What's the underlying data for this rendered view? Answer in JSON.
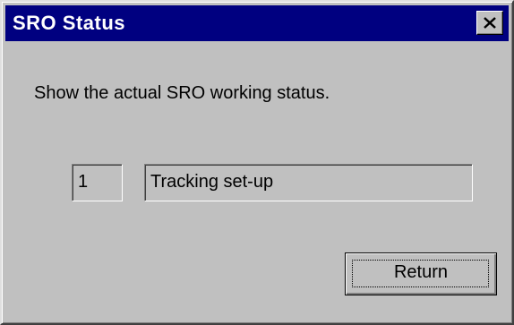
{
  "window": {
    "title": "SRO Status",
    "close_icon": "close-x-icon"
  },
  "body": {
    "description": "Show the actual SRO working status.",
    "status_number": "1",
    "status_text": "Tracking set-up"
  },
  "buttons": {
    "return_label": "Return"
  },
  "colors": {
    "titlebar": "#000080",
    "face": "#c0c0c0",
    "title_text": "#ffffff"
  }
}
